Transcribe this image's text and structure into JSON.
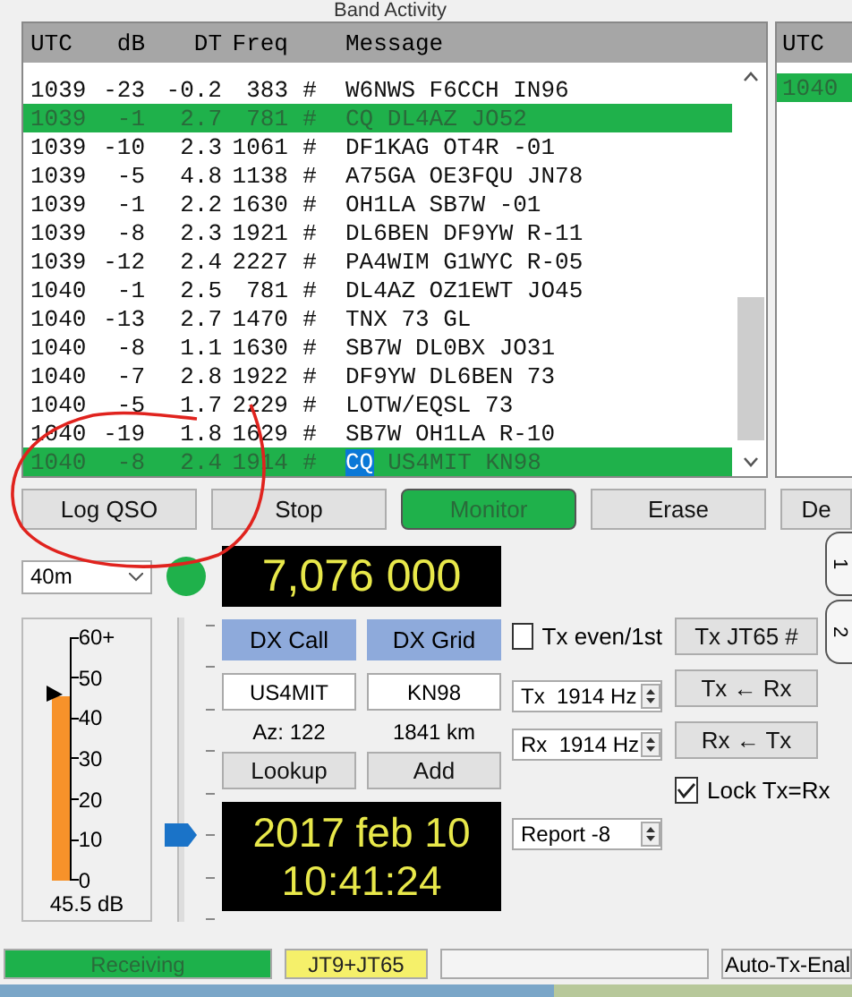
{
  "header": {
    "title": "Band Activity"
  },
  "band_activity": {
    "columns": [
      "UTC",
      "dB",
      "DT",
      "Freq",
      "Message"
    ],
    "rows": [
      {
        "utc": "1039",
        "db": "-23",
        "dt": "-0.2",
        "freq": "383",
        "mode": "#",
        "message": "W6NWS F6CCH IN96",
        "highlighted": false
      },
      {
        "utc": "1039",
        "db": "-1",
        "dt": "2.7",
        "freq": "781",
        "mode": "#",
        "message": "CQ DL4AZ JO52",
        "highlighted": true
      },
      {
        "utc": "1039",
        "db": "-10",
        "dt": "2.3",
        "freq": "1061",
        "mode": "#",
        "message": "DF1KAG OT4R -01",
        "highlighted": false
      },
      {
        "utc": "1039",
        "db": "-5",
        "dt": "4.8",
        "freq": "1138",
        "mode": "#",
        "message": "A75GA OE3FQU JN78",
        "highlighted": false
      },
      {
        "utc": "1039",
        "db": "-1",
        "dt": "2.2",
        "freq": "1630",
        "mode": "#",
        "message": "OH1LA SB7W -01",
        "highlighted": false
      },
      {
        "utc": "1039",
        "db": "-8",
        "dt": "2.3",
        "freq": "1921",
        "mode": "#",
        "message": "DL6BEN DF9YW R-11",
        "highlighted": false
      },
      {
        "utc": "1039",
        "db": "-12",
        "dt": "2.4",
        "freq": "2227",
        "mode": "#",
        "message": "PA4WIM G1WYC R-05",
        "highlighted": false
      },
      {
        "utc": "1040",
        "db": "-1",
        "dt": "2.5",
        "freq": "781",
        "mode": "#",
        "message": "DL4AZ OZ1EWT JO45",
        "highlighted": false
      },
      {
        "utc": "1040",
        "db": "-13",
        "dt": "2.7",
        "freq": "1470",
        "mode": "#",
        "message": "TNX 73 GL",
        "highlighted": false
      },
      {
        "utc": "1040",
        "db": "-8",
        "dt": "1.1",
        "freq": "1630",
        "mode": "#",
        "message": "SB7W DL0BX JO31",
        "highlighted": false
      },
      {
        "utc": "1040",
        "db": "-7",
        "dt": "2.8",
        "freq": "1922",
        "mode": "#",
        "message": "DF9YW DL6BEN 73",
        "highlighted": false
      },
      {
        "utc": "1040",
        "db": "-5",
        "dt": "1.7",
        "freq": "2229",
        "mode": "#",
        "message": "LOTW/EQSL 73",
        "highlighted": false
      },
      {
        "utc": "1040",
        "db": "-19",
        "dt": "1.8",
        "freq": "1629",
        "mode": "#",
        "message": "SB7W OH1LA R-10",
        "highlighted": false
      },
      {
        "utc": "1040",
        "db": "-8",
        "dt": "2.4",
        "freq": "1914",
        "mode": "#",
        "selected_text": "CQ",
        "message": "US4MIT KN98",
        "highlighted": true
      }
    ]
  },
  "rx_frequency": {
    "columns": [
      "UTC"
    ],
    "rows": [
      {
        "utc": "1040",
        "highlighted": true
      }
    ]
  },
  "buttons": [
    {
      "label": "Log QSO",
      "active": false
    },
    {
      "label": "Stop",
      "active": false
    },
    {
      "label": "Monitor",
      "active": true
    },
    {
      "label": "Erase",
      "active": false
    },
    {
      "label": "De",
      "active": false
    }
  ],
  "band": {
    "value": "40m"
  },
  "dial_frequency": "7,076 000",
  "side_tabs": [
    {
      "label": "1"
    },
    {
      "label": "2"
    }
  ],
  "meter": {
    "scale": [
      "60+",
      "50",
      "40",
      "30",
      "20",
      "10",
      "0"
    ],
    "level": 0.76,
    "reading": "45.5 dB"
  },
  "rx_slider": {
    "level": 0.28
  },
  "dx": {
    "call_label": "DX Call",
    "grid_label": "DX Grid",
    "call": "US4MIT",
    "grid": "KN98",
    "azimuth": "Az: 122",
    "distance": "1841 km",
    "buttons": [
      "Lookup",
      "Add"
    ]
  },
  "clock": {
    "date": "2017 feb 10",
    "time": "10:41:24"
  },
  "tx_even": {
    "label": "Tx even/1st",
    "checked": false
  },
  "tx_freq": "Tx  1914 Hz",
  "rx_freq": "Rx  1914 Hz",
  "report": "Report -8",
  "right_buttons": [
    "Tx JT65  #",
    "Tx ← Rx",
    "Rx ← Tx"
  ],
  "lock": {
    "label": "Lock Tx=Rx",
    "checked": true
  },
  "status_bar": [
    {
      "text": "Receiving",
      "color": "#1db14b"
    },
    {
      "text": "JT9+JT65",
      "color": "#f5f06a"
    }
  ],
  "auto_tx": "Auto-Tx-Enal"
}
